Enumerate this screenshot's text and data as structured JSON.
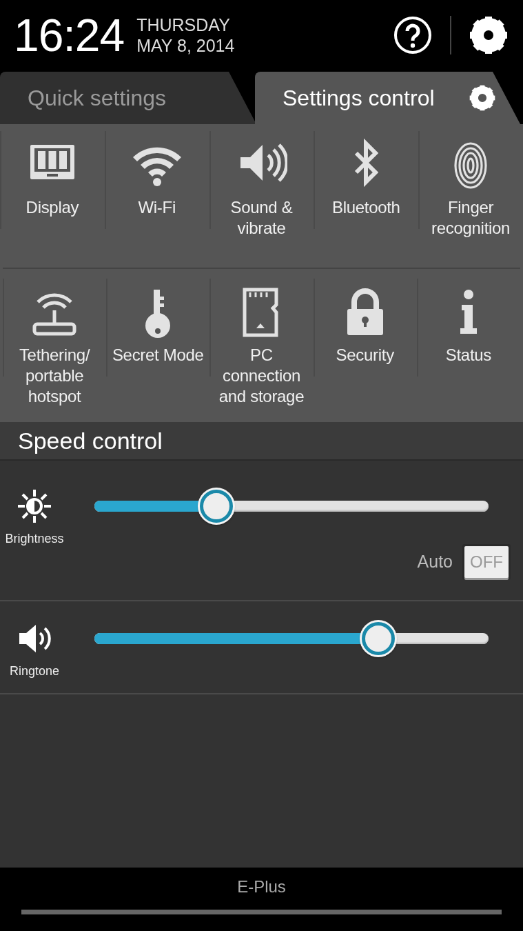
{
  "header": {
    "time": "16:24",
    "weekday": "THURSDAY",
    "date": "MAY 8, 2014"
  },
  "tabs": [
    {
      "label": "Quick settings",
      "selected": false
    },
    {
      "label": "Settings control",
      "selected": true
    }
  ],
  "tiles": [
    {
      "label": "Display"
    },
    {
      "label": "Wi-Fi"
    },
    {
      "label": "Sound & vibrate"
    },
    {
      "label": "Bluetooth"
    },
    {
      "label": "Finger recognition"
    },
    {
      "label": "Tethering/ portable hotspot"
    },
    {
      "label": "Secret Mode"
    },
    {
      "label": "PC connection and storage"
    },
    {
      "label": "Security"
    },
    {
      "label": "Status"
    }
  ],
  "speed_control": {
    "title": "Speed control",
    "sliders": [
      {
        "label": "Brightness",
        "level": 0.31
      },
      {
        "label": "Ringtone",
        "level": 0.72
      }
    ],
    "auto": {
      "label": "Auto",
      "on": false,
      "text": "OFF"
    }
  },
  "carrier": "E-Plus"
}
